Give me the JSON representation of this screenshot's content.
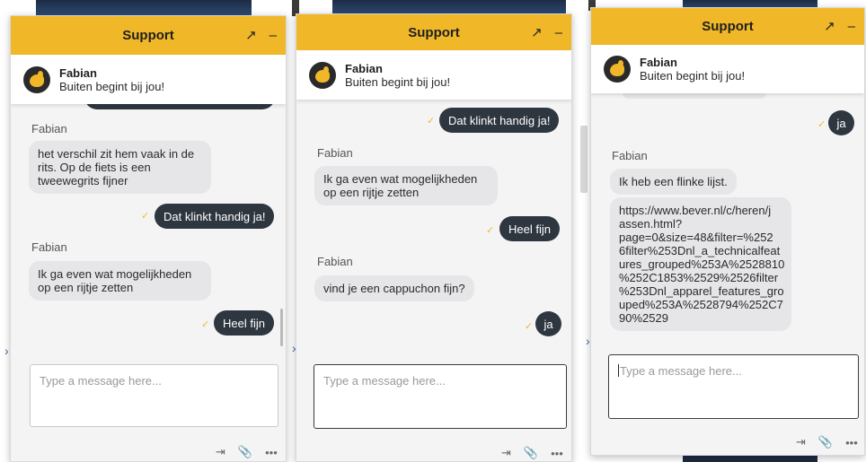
{
  "panels": [
    {
      "id": "panel-1",
      "header_title": "Support",
      "expand_icon": "↗",
      "minimize_icon": "–",
      "agent": {
        "name": "Fabian",
        "tagline": "Buiten begint bij jou!"
      },
      "messages": [
        {
          "type": "sender",
          "text": "Fabian"
        },
        {
          "type": "in",
          "text": "het verschil zit hem vaak in de\nrits. Op de fiets is een\ntweewegrits fijner"
        },
        {
          "type": "out",
          "text": "Dat klinkt handig ja!",
          "check": "✓"
        },
        {
          "type": "sender",
          "text": "Fabian"
        },
        {
          "type": "in",
          "text": "Ik ga even wat mogelijkheden\nop een rijtje zetten"
        },
        {
          "type": "out",
          "text": "Heel fijn",
          "check": "✓"
        }
      ],
      "composer": {
        "placeholder": "Type a message here..."
      },
      "toolbar": {
        "exit_icon": "⇥",
        "attach_icon": "📎",
        "more_icon": "•••"
      }
    },
    {
      "id": "panel-2",
      "header_title": "Support",
      "expand_icon": "↗",
      "minimize_icon": "–",
      "agent": {
        "name": "Fabian",
        "tagline": "Buiten begint bij jou!"
      },
      "messages": [
        {
          "type": "out",
          "text": "Dat klinkt handig ja!",
          "check": "✓"
        },
        {
          "type": "sender",
          "text": "Fabian"
        },
        {
          "type": "in",
          "text": "Ik ga even wat mogelijkheden\nop een rijtje zetten"
        },
        {
          "type": "out",
          "text": "Heel fijn",
          "check": "✓"
        },
        {
          "type": "sender",
          "text": "Fabian"
        },
        {
          "type": "in",
          "text": "vind je een cappuchon fijn?"
        },
        {
          "type": "out",
          "text": "ja",
          "check": "✓"
        }
      ],
      "composer": {
        "placeholder": "Type a message here..."
      },
      "toolbar": {
        "exit_icon": "⇥",
        "attach_icon": "📎",
        "more_icon": "•••"
      }
    },
    {
      "id": "panel-3",
      "header_title": "Support",
      "expand_icon": "↗",
      "minimize_icon": "–",
      "agent": {
        "name": "Fabian",
        "tagline": "Buiten begint bij jou!"
      },
      "messages": [
        {
          "type": "out",
          "text": "ja",
          "check": "✓"
        },
        {
          "type": "sender",
          "text": "Fabian"
        },
        {
          "type": "in",
          "text": "Ik heb een flinke lijst."
        },
        {
          "type": "in",
          "text": "https://www.bever.nl/c/heren/j\nassen.html?\npage=0&size=48&filter=%252\n6filter%253Dnl_a_technicalfeat\nures_grouped%253A%2528810\n%252C1853%2529%2526filter\n%253Dnl_apparel_features_gro\nuped%253A%2528794%252C7\n90%2529"
        }
      ],
      "composer": {
        "placeholder": "Type a message here..."
      },
      "toolbar": {
        "exit_icon": "⇥",
        "attach_icon": "📎",
        "more_icon": "•••"
      }
    }
  ],
  "colors": {
    "header": "#f0b828",
    "out_bubble": "#2e3640",
    "in_bubble": "#e6e6e8",
    "check": "#f0b828"
  },
  "side_chevron_icon": "›"
}
